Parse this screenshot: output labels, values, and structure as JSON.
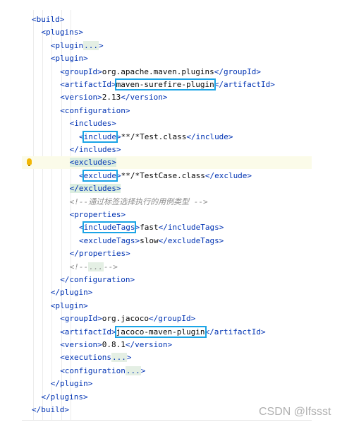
{
  "code": {
    "lines": [
      {
        "indent": 0,
        "hl": false,
        "parts": [
          [
            "tag",
            "<build>"
          ]
        ]
      },
      {
        "indent": 1,
        "hl": false,
        "parts": [
          [
            "tag",
            "<plugins>"
          ]
        ]
      },
      {
        "indent": 2,
        "hl": false,
        "parts": [
          [
            "tag",
            "<plugin"
          ],
          [
            "fold",
            "..."
          ],
          [
            "tag",
            ">"
          ]
        ]
      },
      {
        "indent": 2,
        "hl": false,
        "parts": [
          [
            "tag",
            "<plugin>"
          ]
        ]
      },
      {
        "indent": 3,
        "hl": false,
        "parts": [
          [
            "tag",
            "<groupId>"
          ],
          [
            "txt",
            "org.apache.maven.plugins"
          ],
          [
            "tag",
            "</groupId>"
          ]
        ]
      },
      {
        "indent": 3,
        "hl": false,
        "parts": [
          [
            "tag",
            "<artifactId>"
          ],
          [
            "boxtxt",
            "maven-surefire-plugin"
          ],
          [
            "tag",
            "</artifactId>"
          ]
        ]
      },
      {
        "indent": 3,
        "hl": false,
        "parts": [
          [
            "tag",
            "<version>"
          ],
          [
            "txt",
            "2.13"
          ],
          [
            "tag",
            "</version>"
          ]
        ]
      },
      {
        "indent": 3,
        "hl": false,
        "parts": [
          [
            "tag",
            "<configuration>"
          ]
        ]
      },
      {
        "indent": 4,
        "hl": false,
        "parts": [
          [
            "tag",
            "<includes>"
          ]
        ]
      },
      {
        "indent": 5,
        "hl": false,
        "parts": [
          [
            "tag",
            "<"
          ],
          [
            "boxtag",
            "include"
          ],
          [
            "tag",
            ">"
          ],
          [
            "txt",
            "**/*Test.class"
          ],
          [
            "tag",
            "</include>"
          ]
        ]
      },
      {
        "indent": 4,
        "hl": false,
        "parts": [
          [
            "tag",
            "</includes>"
          ]
        ]
      },
      {
        "indent": 4,
        "hl": true,
        "parts": [
          [
            "hltag",
            "<excludes>"
          ]
        ]
      },
      {
        "indent": 5,
        "hl": false,
        "parts": [
          [
            "tag",
            "<"
          ],
          [
            "boxtag",
            "exclude"
          ],
          [
            "tag",
            ">"
          ],
          [
            "txt",
            "**/*TestCase.class"
          ],
          [
            "tag",
            "</exclude>"
          ]
        ]
      },
      {
        "indent": 4,
        "hl": false,
        "parts": [
          [
            "hltag",
            "</excludes>"
          ]
        ]
      },
      {
        "indent": 4,
        "hl": false,
        "parts": [
          [
            "cmt",
            "<!--通过标签选择执行的用例类型 -->"
          ]
        ]
      },
      {
        "indent": 4,
        "hl": false,
        "parts": [
          [
            "tag",
            "<properties>"
          ]
        ]
      },
      {
        "indent": 5,
        "hl": false,
        "parts": [
          [
            "tag",
            "<"
          ],
          [
            "boxtag",
            "includeTags"
          ],
          [
            "tag",
            ">"
          ],
          [
            "txt",
            "fast"
          ],
          [
            "tag",
            "</includeTags>"
          ]
        ]
      },
      {
        "indent": 5,
        "hl": false,
        "parts": [
          [
            "tag",
            "<excludeTags>"
          ],
          [
            "txt",
            "slow"
          ],
          [
            "tag",
            "</excludeTags>"
          ]
        ]
      },
      {
        "indent": 4,
        "hl": false,
        "parts": [
          [
            "tag",
            "</properties>"
          ]
        ]
      },
      {
        "indent": 4,
        "hl": false,
        "parts": [
          [
            "cmt",
            "<!--"
          ],
          [
            "foldc",
            "..."
          ],
          [
            "cmt",
            "-->"
          ]
        ]
      },
      {
        "indent": 3,
        "hl": false,
        "parts": [
          [
            "tag",
            "</configuration>"
          ]
        ]
      },
      {
        "indent": 2,
        "hl": false,
        "parts": [
          [
            "tag",
            "</plugin>"
          ]
        ]
      },
      {
        "indent": 2,
        "hl": false,
        "parts": [
          [
            "tag",
            "<plugin>"
          ]
        ]
      },
      {
        "indent": 3,
        "hl": false,
        "parts": [
          [
            "tag",
            "<groupId>"
          ],
          [
            "txt",
            "org.jacoco"
          ],
          [
            "tag",
            "</groupId>"
          ]
        ]
      },
      {
        "indent": 3,
        "hl": false,
        "parts": [
          [
            "tag",
            "<artifactId>"
          ],
          [
            "boxtxt",
            "jacoco-maven-plugin"
          ],
          [
            "tag",
            "</artifactId>"
          ]
        ]
      },
      {
        "indent": 3,
        "hl": false,
        "parts": [
          [
            "tag",
            "<version>"
          ],
          [
            "txt",
            "0.8.1"
          ],
          [
            "tag",
            "</version>"
          ]
        ]
      },
      {
        "indent": 3,
        "hl": false,
        "parts": [
          [
            "tag",
            "<executions"
          ],
          [
            "fold",
            "..."
          ],
          [
            "tag",
            ">"
          ]
        ]
      },
      {
        "indent": 3,
        "hl": false,
        "parts": [
          [
            "tag",
            "<configuration"
          ],
          [
            "fold",
            "..."
          ],
          [
            "tag",
            ">"
          ]
        ]
      },
      {
        "indent": 2,
        "hl": false,
        "parts": [
          [
            "tag",
            "</plugin>"
          ]
        ]
      },
      {
        "indent": 1,
        "hl": false,
        "parts": [
          [
            "tag",
            "</plugins>"
          ]
        ]
      },
      {
        "indent": 0,
        "hl": false,
        "parts": [
          [
            "tag",
            "</build>"
          ]
        ]
      }
    ]
  },
  "watermark": "CSDN @lfssst",
  "colors": {
    "tag": "#0033b3",
    "text": "#080808",
    "comment": "#8c8c8c",
    "highlight_box": "#1aa4e6",
    "line_highlight": "#fbfbe9",
    "bulb": "#f2b705"
  },
  "icons": {
    "gutter": "lightbulb-icon"
  }
}
